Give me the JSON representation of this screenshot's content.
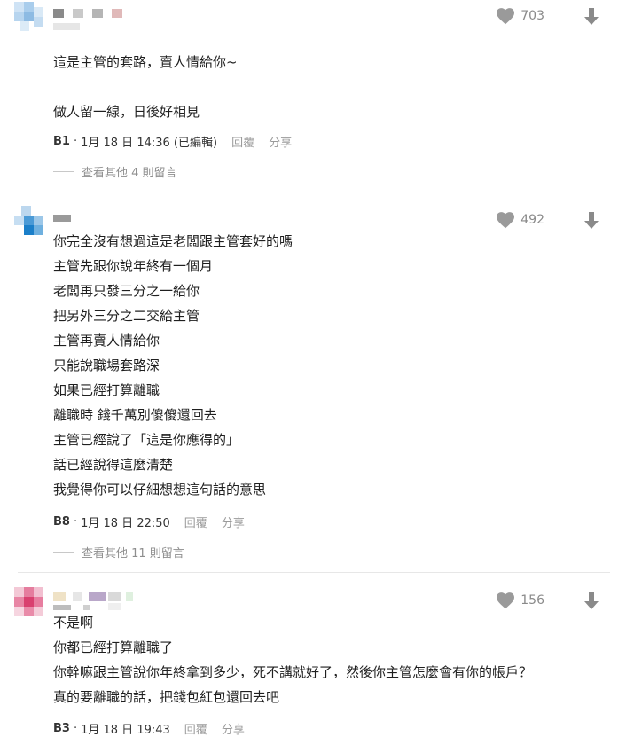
{
  "comments": [
    {
      "likes": "703",
      "lines": [
        "這是主管的套路，賣人情給你~",
        "",
        "做人留一線，日後好相見"
      ],
      "floor": "B1",
      "sep": "·",
      "datetime": "1月 18 日 14:36 (已編輯)",
      "reply_label": "回覆",
      "share_label": "分享",
      "view_more": "查看其他 4 則留言"
    },
    {
      "likes": "492",
      "lines": [
        "你完全沒有想過這是老闆跟主管套好的嗎",
        "主管先跟你說年終有一個月",
        "老闆再只發三分之一給你",
        "把另外三分之二交給主管",
        "主管再賣人情給你",
        "只能說職場套路深",
        "如果已經打算離職",
        "離職時 錢千萬別傻傻還回去",
        "主管已經說了「這是你應得的」",
        "話已經說得這麼清楚",
        "我覺得你可以仔細想想這句話的意思"
      ],
      "floor": "B8",
      "sep": "·",
      "datetime": "1月 18 日 22:50",
      "reply_label": "回覆",
      "share_label": "分享",
      "view_more": "查看其他 11 則留言"
    },
    {
      "likes": "156",
      "lines": [
        "不是啊",
        "你都已經打算離職了",
        "你幹嘛跟主管說你年終拿到多少，死不講就好了，然後你主管怎麼會有你的帳戶？",
        "真的要離職的話，把錢包紅包還回去吧"
      ],
      "floor": "B3",
      "sep": "·",
      "datetime": "1月 18 日 19:43",
      "reply_label": "回覆",
      "share_label": "分享"
    }
  ],
  "colors": {
    "icon_gray": "#9a9a9a",
    "text": "#1f1f1f",
    "meta_gray": "#9a9a9a",
    "divider": "#e7e7e7"
  },
  "icons": {
    "like": "heart-icon",
    "dislike": "arrow-down-icon"
  }
}
